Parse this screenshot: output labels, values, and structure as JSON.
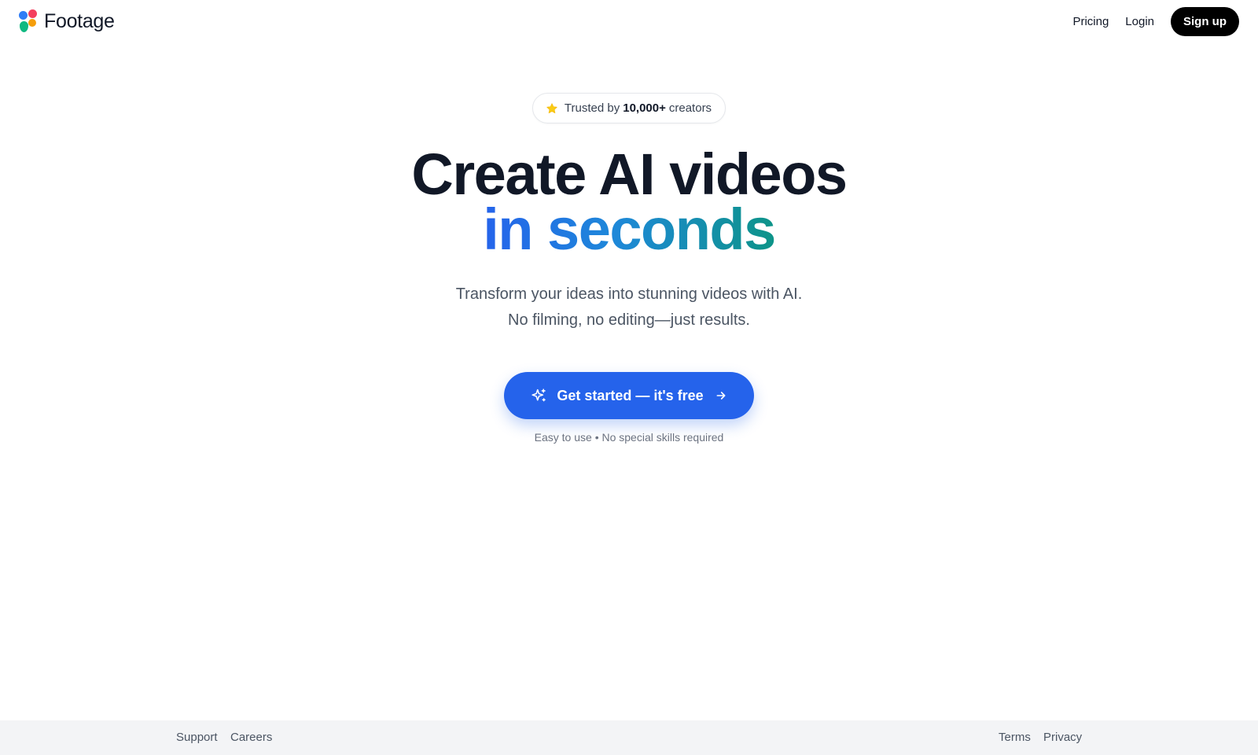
{
  "brand": {
    "name": "Footage"
  },
  "nav": {
    "pricing": "Pricing",
    "login": "Login",
    "signup": "Sign up"
  },
  "hero": {
    "trusted_prefix": "Trusted by",
    "trusted_count": "10,000+",
    "trusted_suffix": "creators",
    "headline_line1": "Create AI videos",
    "headline_line2": "in seconds",
    "subtitle_line1": "Transform your ideas into stunning videos with AI.",
    "subtitle_line2": "No filming, no editing—just results.",
    "cta_label": "Get started — it's free",
    "note": "Easy to use • No special skills required"
  },
  "footer": {
    "support": "Support",
    "careers": "Careers",
    "terms": "Terms",
    "privacy": "Privacy"
  },
  "colors": {
    "accent": "#2563eb",
    "star": "#facc15",
    "text": "#111827",
    "footer_bg": "#f3f4f6"
  },
  "icons": {
    "logo": "four-dot-logo-icon",
    "star": "star-icon",
    "sparkle": "sparkle-icon",
    "arrow": "arrow-right-icon"
  }
}
